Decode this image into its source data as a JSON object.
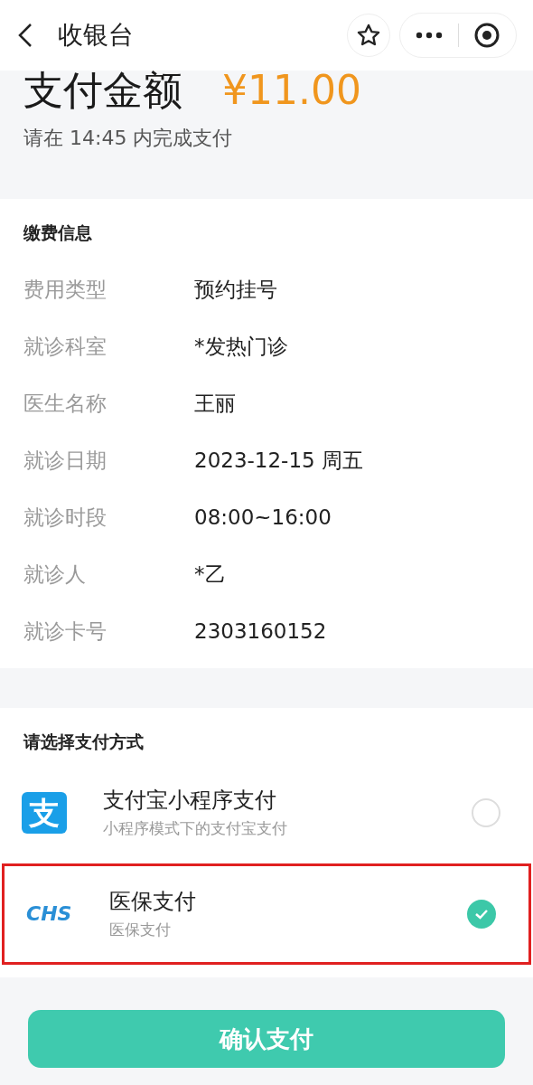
{
  "header": {
    "title": "收银台"
  },
  "amount": {
    "label": "支付金额",
    "value": "¥11.00",
    "deadline": "请在 14:45 内完成支付"
  },
  "info": {
    "title": "缴费信息",
    "rows": [
      {
        "label": "费用类型",
        "value": "预约挂号"
      },
      {
        "label": "就诊科室",
        "value": "*发热门诊"
      },
      {
        "label": "医生名称",
        "value": "王丽"
      },
      {
        "label": "就诊日期",
        "value": "2023-12-15 周五"
      },
      {
        "label": "就诊时段",
        "value": "08:00~16:00"
      },
      {
        "label": "就诊人",
        "value": "*乙"
      },
      {
        "label": "就诊卡号",
        "value": "2303160152"
      }
    ]
  },
  "payment": {
    "title": "请选择支付方式",
    "methods": [
      {
        "kind": "alipay",
        "logo_text": "支",
        "name": "支付宝小程序支付",
        "description": "小程序模式下的支付宝支付",
        "selected": false,
        "highlighted": false
      },
      {
        "kind": "chs",
        "logo_text": "CHS",
        "name": "医保支付",
        "description": "医保支付",
        "selected": true,
        "highlighted": true
      }
    ]
  },
  "confirm_button": "确认支付"
}
